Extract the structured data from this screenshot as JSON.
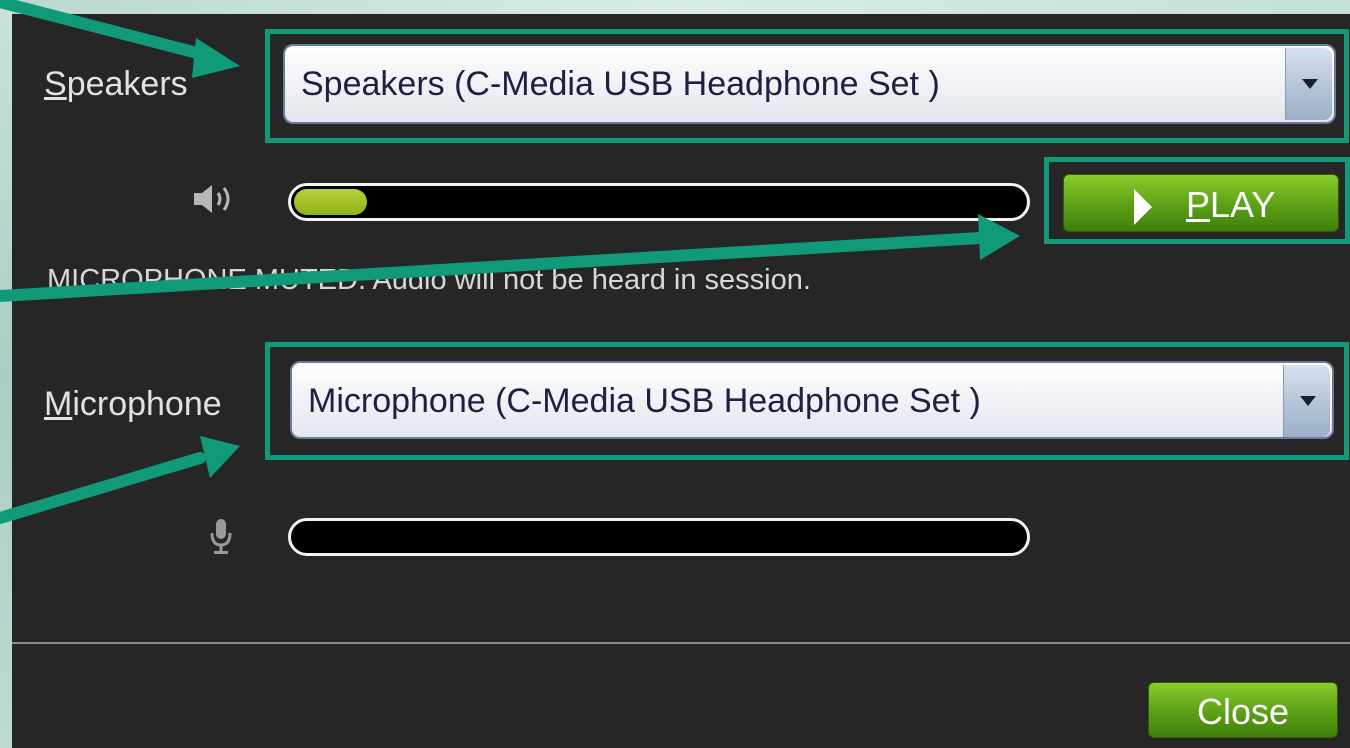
{
  "speakers": {
    "label_underlined": "S",
    "label_rest": "peakers",
    "selected": "Speakers (C-Media USB Headphone Set )",
    "volume_level": 0.1
  },
  "play_button": {
    "label_underlined": "P",
    "label_rest": "LAY"
  },
  "status_message": "MICROPHONE MUTED. Audio will not be heard in session.",
  "microphone": {
    "label_underlined": "M",
    "label_rest": "icrophone",
    "selected": "Microphone (C-Media USB Headphone Set )",
    "input_level": 0
  },
  "close_button": {
    "label": "Close"
  },
  "icons": {
    "speaker": "speaker-volume-icon",
    "mic": "microphone-icon",
    "dropdown": "chevron-down-icon",
    "play": "play-icon"
  },
  "colors": {
    "highlight": "#119a78",
    "button_green": "#5ea317",
    "meter_fill": "#9dbf24"
  }
}
